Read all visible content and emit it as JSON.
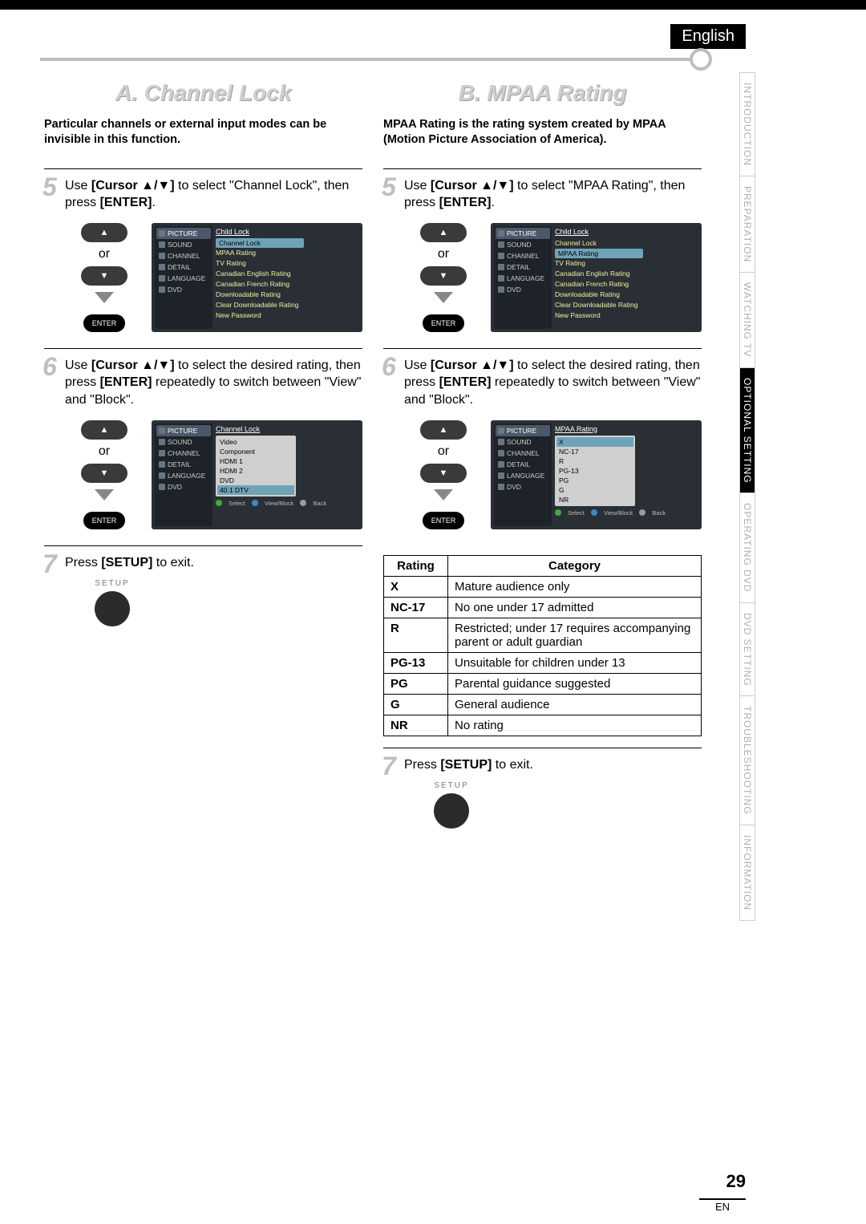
{
  "lang": "English",
  "tabs": [
    "INTRODUCTION",
    "PREPARATION",
    "WATCHING TV",
    "OPTIONAL SETTING",
    "OPERATING DVD",
    "DVD SETTING",
    "TROUBLESHOOTING",
    "INFORMATION"
  ],
  "active_tab_index": 3,
  "left": {
    "title": "A.  Channel Lock",
    "intro": "Particular channels or external input modes can be invisible in this function.",
    "step5": {
      "n": "5",
      "pre": "Use ",
      "key": "[Cursor ▲/▼]",
      "mid": " to select \"Channel Lock\", then press ",
      "key2": "[ENTER]",
      "post": "."
    },
    "step6": {
      "n": "6",
      "pre": "Use ",
      "key": "[Cursor ▲/▼]",
      "mid": " to select the desired rating, then press ",
      "key2": "[ENTER]",
      "post": " repeatedly to switch between \"View\" and \"Block\"."
    },
    "step7": {
      "n": "7",
      "pre": "Press ",
      "key": "[SETUP]",
      "post": " to exit."
    },
    "or": "or",
    "enter": "ENTER",
    "setup": "SETUP",
    "osd_side": [
      "PICTURE",
      "SOUND",
      "CHANNEL",
      "DETAIL",
      "LANGUAGE",
      "DVD"
    ],
    "osd1_title": "Child Lock",
    "osd1_items": [
      "Channel Lock",
      "MPAA Rating",
      "TV Rating",
      "Canadian English Rating",
      "Canadian French Rating",
      "Downloadable Rating",
      "Clear Downloadable Rating",
      "New Password"
    ],
    "osd1_sel": 0,
    "osd2_title": "Channel Lock",
    "osd2_items": [
      "Video",
      "Component",
      "HDMI 1",
      "HDMI 2",
      "DVD",
      "40.1 DTV"
    ],
    "osd_footer": [
      "Select",
      "View/Block",
      "Back"
    ]
  },
  "right": {
    "title": "B. MPAA Rating",
    "intro": "MPAA Rating is the rating system created by MPAA (Motion Picture Association of America).",
    "step5": {
      "n": "5",
      "pre": "Use ",
      "key": "[Cursor ▲/▼]",
      "mid": " to select \"MPAA Rating\", then press ",
      "key2": "[ENTER]",
      "post": "."
    },
    "step6": {
      "n": "6",
      "pre": "Use ",
      "key": "[Cursor ▲/▼]",
      "mid": " to select the desired rating, then press ",
      "key2": "[ENTER]",
      "post": " repeatedly to switch between \"View\" and \"Block\"."
    },
    "step7": {
      "n": "7",
      "pre": "Press ",
      "key": "[SETUP]",
      "post": " to exit."
    },
    "or": "or",
    "enter": "ENTER",
    "setup": "SETUP",
    "osd_side": [
      "PICTURE",
      "SOUND",
      "CHANNEL",
      "DETAIL",
      "LANGUAGE",
      "DVD"
    ],
    "osd1_title": "Child Lock",
    "osd1_items": [
      "Channel Lock",
      "MPAA Rating",
      "TV Rating",
      "Canadian English Rating",
      "Canadian French Rating",
      "Downloadable Rating",
      "Clear Downloadable Rating",
      "New Password"
    ],
    "osd1_sel": 1,
    "osd2_title": "MPAA Rating",
    "osd2_items": [
      "X",
      "NC-17",
      "R",
      "PG-13",
      "PG",
      "G",
      "NR"
    ],
    "osd_footer": [
      "Select",
      "View/Block",
      "Back"
    ],
    "table_header": [
      "Rating",
      "Category"
    ],
    "table_rows": [
      [
        "X",
        "Mature audience only"
      ],
      [
        "NC-17",
        "No one under 17 admitted"
      ],
      [
        "R",
        "Restricted; under 17 requires accompanying parent or adult guardian"
      ],
      [
        "PG-13",
        "Unsuitable for children under 13"
      ],
      [
        "PG",
        "Parental guidance suggested"
      ],
      [
        "G",
        "General audience"
      ],
      [
        "NR",
        "No rating"
      ]
    ]
  },
  "page_number": "29",
  "page_lang": "EN"
}
